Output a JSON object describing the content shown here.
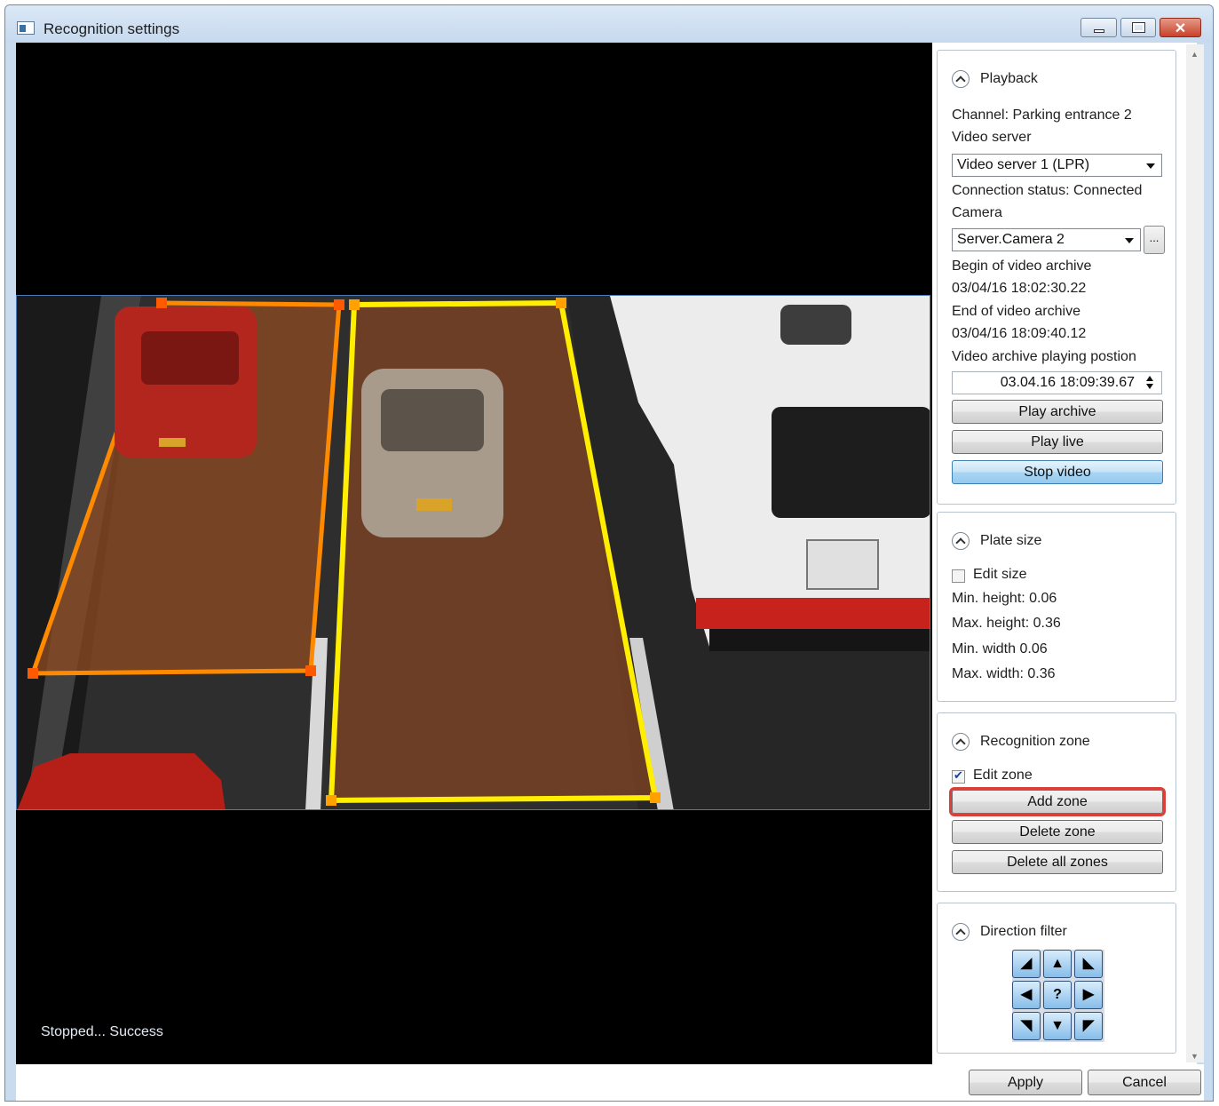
{
  "window": {
    "title": "Recognition settings"
  },
  "video": {
    "status": "Stopped... Success"
  },
  "playback": {
    "title": "Playback",
    "channel": "Channel: Parking entrance 2",
    "video_server_label": "Video server",
    "video_server_value": "Video server 1 (LPR)",
    "connection_status": "Connection status: Connected",
    "camera_label": "Camera",
    "camera_value": "Server.Camera 2",
    "camera_browse": "...",
    "archive_begin_label": "Begin of video archive",
    "archive_begin_value": "03/04/16 18:02:30.22",
    "archive_end_label": "End of video archive",
    "archive_end_value": "03/04/16 18:09:40.12",
    "position_label": "Video archive playing postion",
    "position_value": "03.04.16 18:09:39.67",
    "play_archive": "Play archive",
    "play_live": "Play live",
    "stop_video": "Stop video"
  },
  "plate_size": {
    "title": "Plate size",
    "edit_size": "Edit size",
    "edit_size_checked": false,
    "min_height": "Min. height: 0.06",
    "max_height": "Max. height: 0.36",
    "min_width": "Min. width 0.06",
    "max_width": "Max. width: 0.36"
  },
  "recognition_zone": {
    "title": "Recognition zone",
    "edit_zone": "Edit zone",
    "edit_zone_checked": true,
    "add_zone": "Add zone",
    "delete_zone": "Delete zone",
    "delete_all_zones": "Delete all zones"
  },
  "direction_filter": {
    "title": "Direction filter",
    "center_label": "?"
  },
  "footer": {
    "apply": "Apply",
    "cancel": "Cancel"
  },
  "colors": {
    "zone_orange": "#ff8a00",
    "zone_yellow": "#ffee00",
    "zone_fill": "#8a4a23",
    "highlight": "#d9403a",
    "active_button": "#a9d5f3"
  }
}
